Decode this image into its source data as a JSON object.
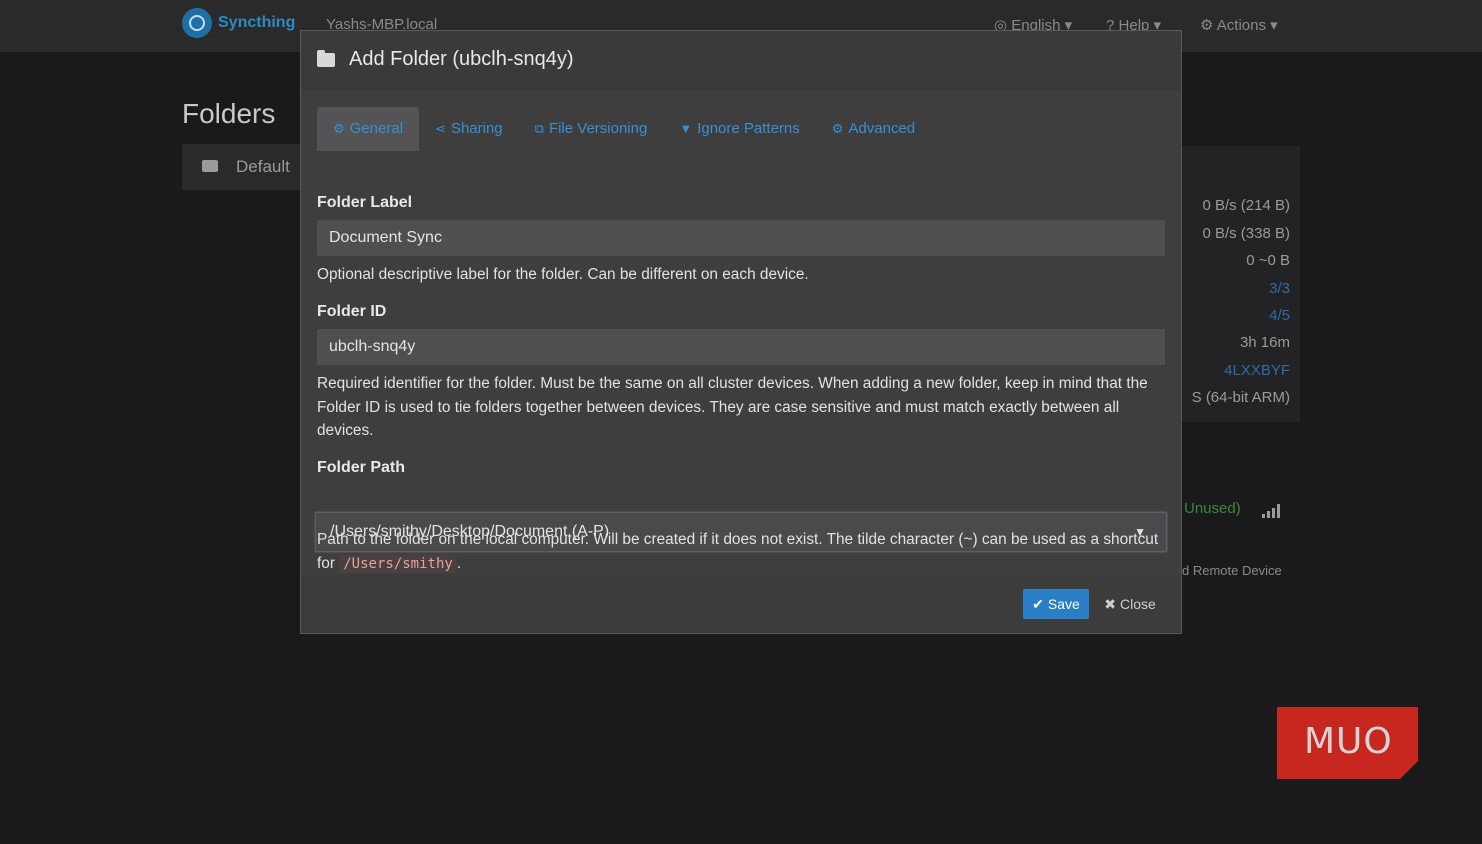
{
  "navbar": {
    "brand": "Syncthing",
    "device": "Yashs-MBP.local",
    "language": "English",
    "help": "Help",
    "actions": "Actions"
  },
  "background": {
    "title": "Folders",
    "folder_label": "Default",
    "stats": [
      "0 B/s (214 B)",
      "0 B/s (338 B)",
      "0  ~0 B",
      "3/3",
      "4/5",
      "3h 16m",
      "4LXXBYF",
      "S (64-bit ARM)"
    ],
    "unused": "Unused)",
    "remote_device": "d Remote Device"
  },
  "modal": {
    "title": "Add Folder (ubclh-snq4y)",
    "tabs": [
      {
        "label": "General",
        "icon": "gear-icon",
        "active": true
      },
      {
        "label": "Sharing",
        "icon": "share-icon"
      },
      {
        "label": "File Versioning",
        "icon": "copy-icon"
      },
      {
        "label": "Ignore Patterns",
        "icon": "filter-icon"
      },
      {
        "label": "Advanced",
        "icon": "gears-icon"
      }
    ],
    "folder_label": {
      "label": "Folder Label",
      "value": "Document Sync",
      "help": "Optional descriptive label for the folder. Can be different on each device."
    },
    "folder_id": {
      "label": "Folder ID",
      "value": "ubclh-snq4y",
      "help": "Required identifier for the folder. Must be the same on all cluster devices. When adding a new folder, keep in mind that the Folder ID is used to tie folders together between devices. They are case sensitive and must match exactly between all devices."
    },
    "folder_path": {
      "label": "Folder Path",
      "value": "/Users/smithy/Desktop/Document (A-P)",
      "help_prefix": "Path to the folder on the local computer. Will be created if it does not exist. The tilde character (~) can be used as a shortcut for",
      "help_code": "/Users/smithy",
      "help_suffix": "."
    },
    "save": "Save",
    "close": "Close"
  },
  "watermark": "MUO",
  "colors": {
    "accent": "#2a7ec6",
    "link": "#3a8fd0",
    "watermark_bg": "#c7271f"
  }
}
